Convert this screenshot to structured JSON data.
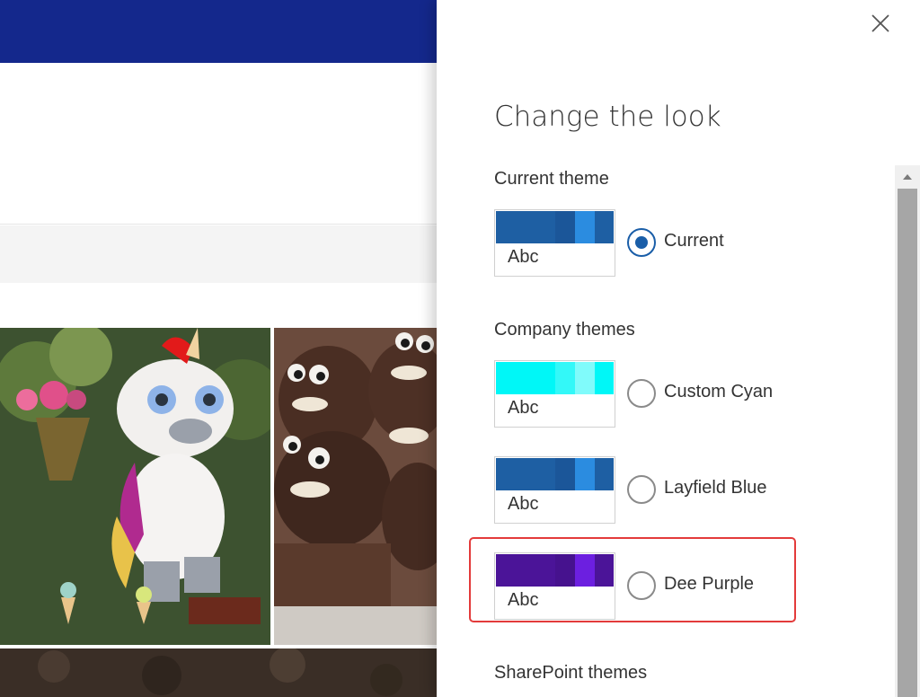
{
  "panel": {
    "title": "Change the look",
    "close_icon": "close-icon"
  },
  "sections": {
    "current": "Current theme",
    "company": "Company themes",
    "sharepoint": "SharePoint themes"
  },
  "themes": [
    {
      "id": "current",
      "label": "Current",
      "sample_text": "Abc",
      "selected": true,
      "colors": [
        "#1e5fa3",
        "#1e5fa3",
        "#1b5699",
        "#2b8ce0",
        "#1e5fa3"
      ]
    },
    {
      "id": "custom-cyan",
      "label": "Custom Cyan",
      "sample_text": "Abc",
      "selected": false,
      "colors": [
        "#00f7f7",
        "#00f7f7",
        "#33f8f8",
        "#80fbfb",
        "#00f7f7"
      ]
    },
    {
      "id": "layfield-blue",
      "label": "Layfield Blue",
      "sample_text": "Abc",
      "selected": false,
      "colors": [
        "#1e5fa3",
        "#1e5fa3",
        "#1b5699",
        "#2b8ce0",
        "#1e5fa3"
      ]
    },
    {
      "id": "dee-purple",
      "label": "Dee Purple",
      "sample_text": "Abc",
      "selected": false,
      "colors": [
        "#4b1498",
        "#4b1498",
        "#46128e",
        "#6c1fe0",
        "#4b1498"
      ]
    }
  ],
  "colors": {
    "suite_bar": "#14288c",
    "highlight": "#e33b3b",
    "radio_selected": "#1a5ea8"
  }
}
